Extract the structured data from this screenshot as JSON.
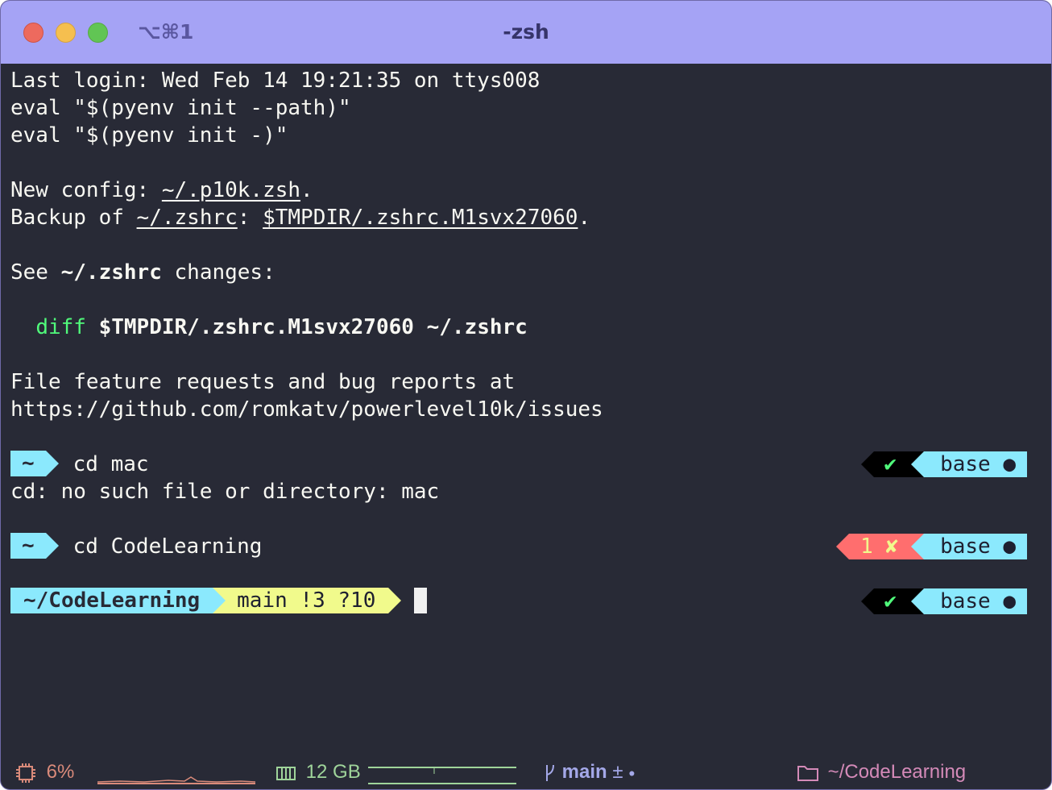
{
  "window": {
    "shortcut": "⌥⌘1",
    "title": "-zsh"
  },
  "output": {
    "login": "Last login: Wed Feb 14 19:21:35 on ttys008",
    "eval1": "eval \"$(pyenv init --path)\"",
    "eval2": "eval \"$(pyenv init -)\"",
    "new_config_prefix": "New config: ",
    "new_config_file": "~/.p10k.zsh",
    "new_config_suffix": ".",
    "backup_prefix": "Backup of ",
    "backup_file": "~/.zshrc",
    "backup_colon": ": ",
    "backup_target": "$TMPDIR/.zshrc.M1svx27060",
    "backup_suffix": ".",
    "see_prefix": "See ",
    "see_file": "~/.zshrc",
    "see_suffix": " changes:",
    "diff_cmd": "diff",
    "diff_args": " $TMPDIR/.zshrc.M1svx27060 ~/.zshrc",
    "file_feature": "File feature requests and bug reports at",
    "issues_url": "https://github.com/romkatv/powerlevel10k/issues",
    "cd_error": "cd: no such file or directory: mac"
  },
  "prompts": [
    {
      "dir": "~",
      "command": "cd mac",
      "status": "✔",
      "env": "base"
    },
    {
      "dir": "~",
      "command": "cd CodeLearning",
      "status_code": "1",
      "status": "✘",
      "env": "base"
    },
    {
      "dir": "~/CodeLearning",
      "git": "main !3 ?10",
      "status": "✔",
      "env": "base"
    }
  ],
  "statusbar": {
    "cpu_percent": "6%",
    "memory": "12 GB",
    "git_branch": "main",
    "git_dirty": "±",
    "path": "~/CodeLearning"
  },
  "colors": {
    "titlebar": "#a5a3f5",
    "background": "#282a36",
    "dir_segment": "#8be9fd",
    "git_segment": "#f1fa8c",
    "error_segment": "#ff6e6e",
    "ok_check": "#50fa7b"
  }
}
